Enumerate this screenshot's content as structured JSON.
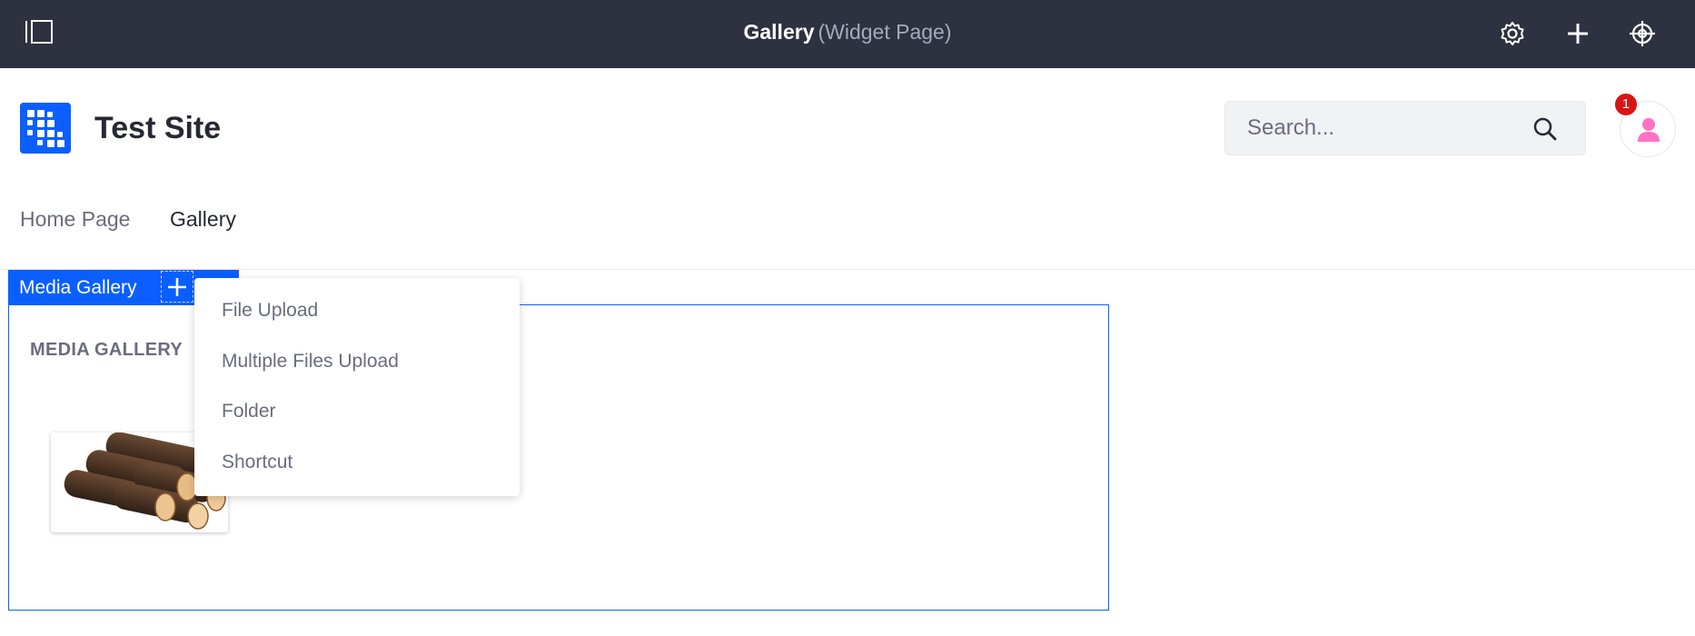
{
  "control_bar": {
    "title": "Gallery",
    "subtitle": "(Widget Page)",
    "icons": [
      "sidebar-toggle-icon",
      "gear-icon",
      "plus-icon",
      "simulation-icon"
    ]
  },
  "header": {
    "site_name": "Test Site",
    "search_placeholder": "Search...",
    "notification_count": "1"
  },
  "nav": {
    "items": [
      {
        "label": "Home Page",
        "active": false
      },
      {
        "label": "Gallery",
        "active": true
      }
    ]
  },
  "portlet": {
    "topper_title": "Media Gallery",
    "heading": "MEDIA GALLERY",
    "thumbnail_icon": "logs-image"
  },
  "add_menu": {
    "items": [
      "File Upload",
      "Multiple Files Upload",
      "Folder",
      "Shortcut"
    ]
  },
  "colors": {
    "control_bar": "#2e3140",
    "primary": "#0b5fff",
    "badge": "#da1414",
    "avatar_icon": "#ff73c3"
  }
}
